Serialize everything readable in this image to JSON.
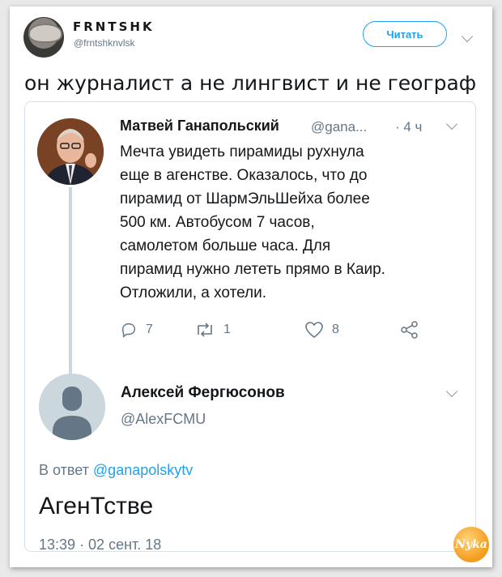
{
  "embed": {
    "display_name": "FRNTSHK",
    "handle": "@frntshknvlsk",
    "follow_label": "Читать",
    "text": "он журналист а не лингвист и не географ"
  },
  "quoted": {
    "name": "Матвей Ганапольский",
    "handle": "@gana...",
    "time": "· 4 ч",
    "text": "Мечта увидеть пирамиды рухнула\nеще в агенстве. Оказалось, что до\nпирамид от ШармЭльШейха более\n500 км. Автобусом 7 часов,\nсамолетом больше часа. Для\nпирамид нужно лететь прямо в Каир.\nОтложили, а хотели.",
    "actions": {
      "replies": "7",
      "retweets": "1",
      "likes": "8"
    }
  },
  "reply": {
    "name": "Алексей Фергюсонов",
    "handle": "@AlexFCMU",
    "reply_prefix": "В ответ",
    "reply_to": "@ganapolskytv",
    "text": "АгенТстве",
    "timestamp": "13:39 · 02 сент. 18"
  },
  "watermark": "Nyka",
  "colors": {
    "accent": "#1da1f2",
    "muted": "#657786",
    "border": "#d9e1e8"
  }
}
